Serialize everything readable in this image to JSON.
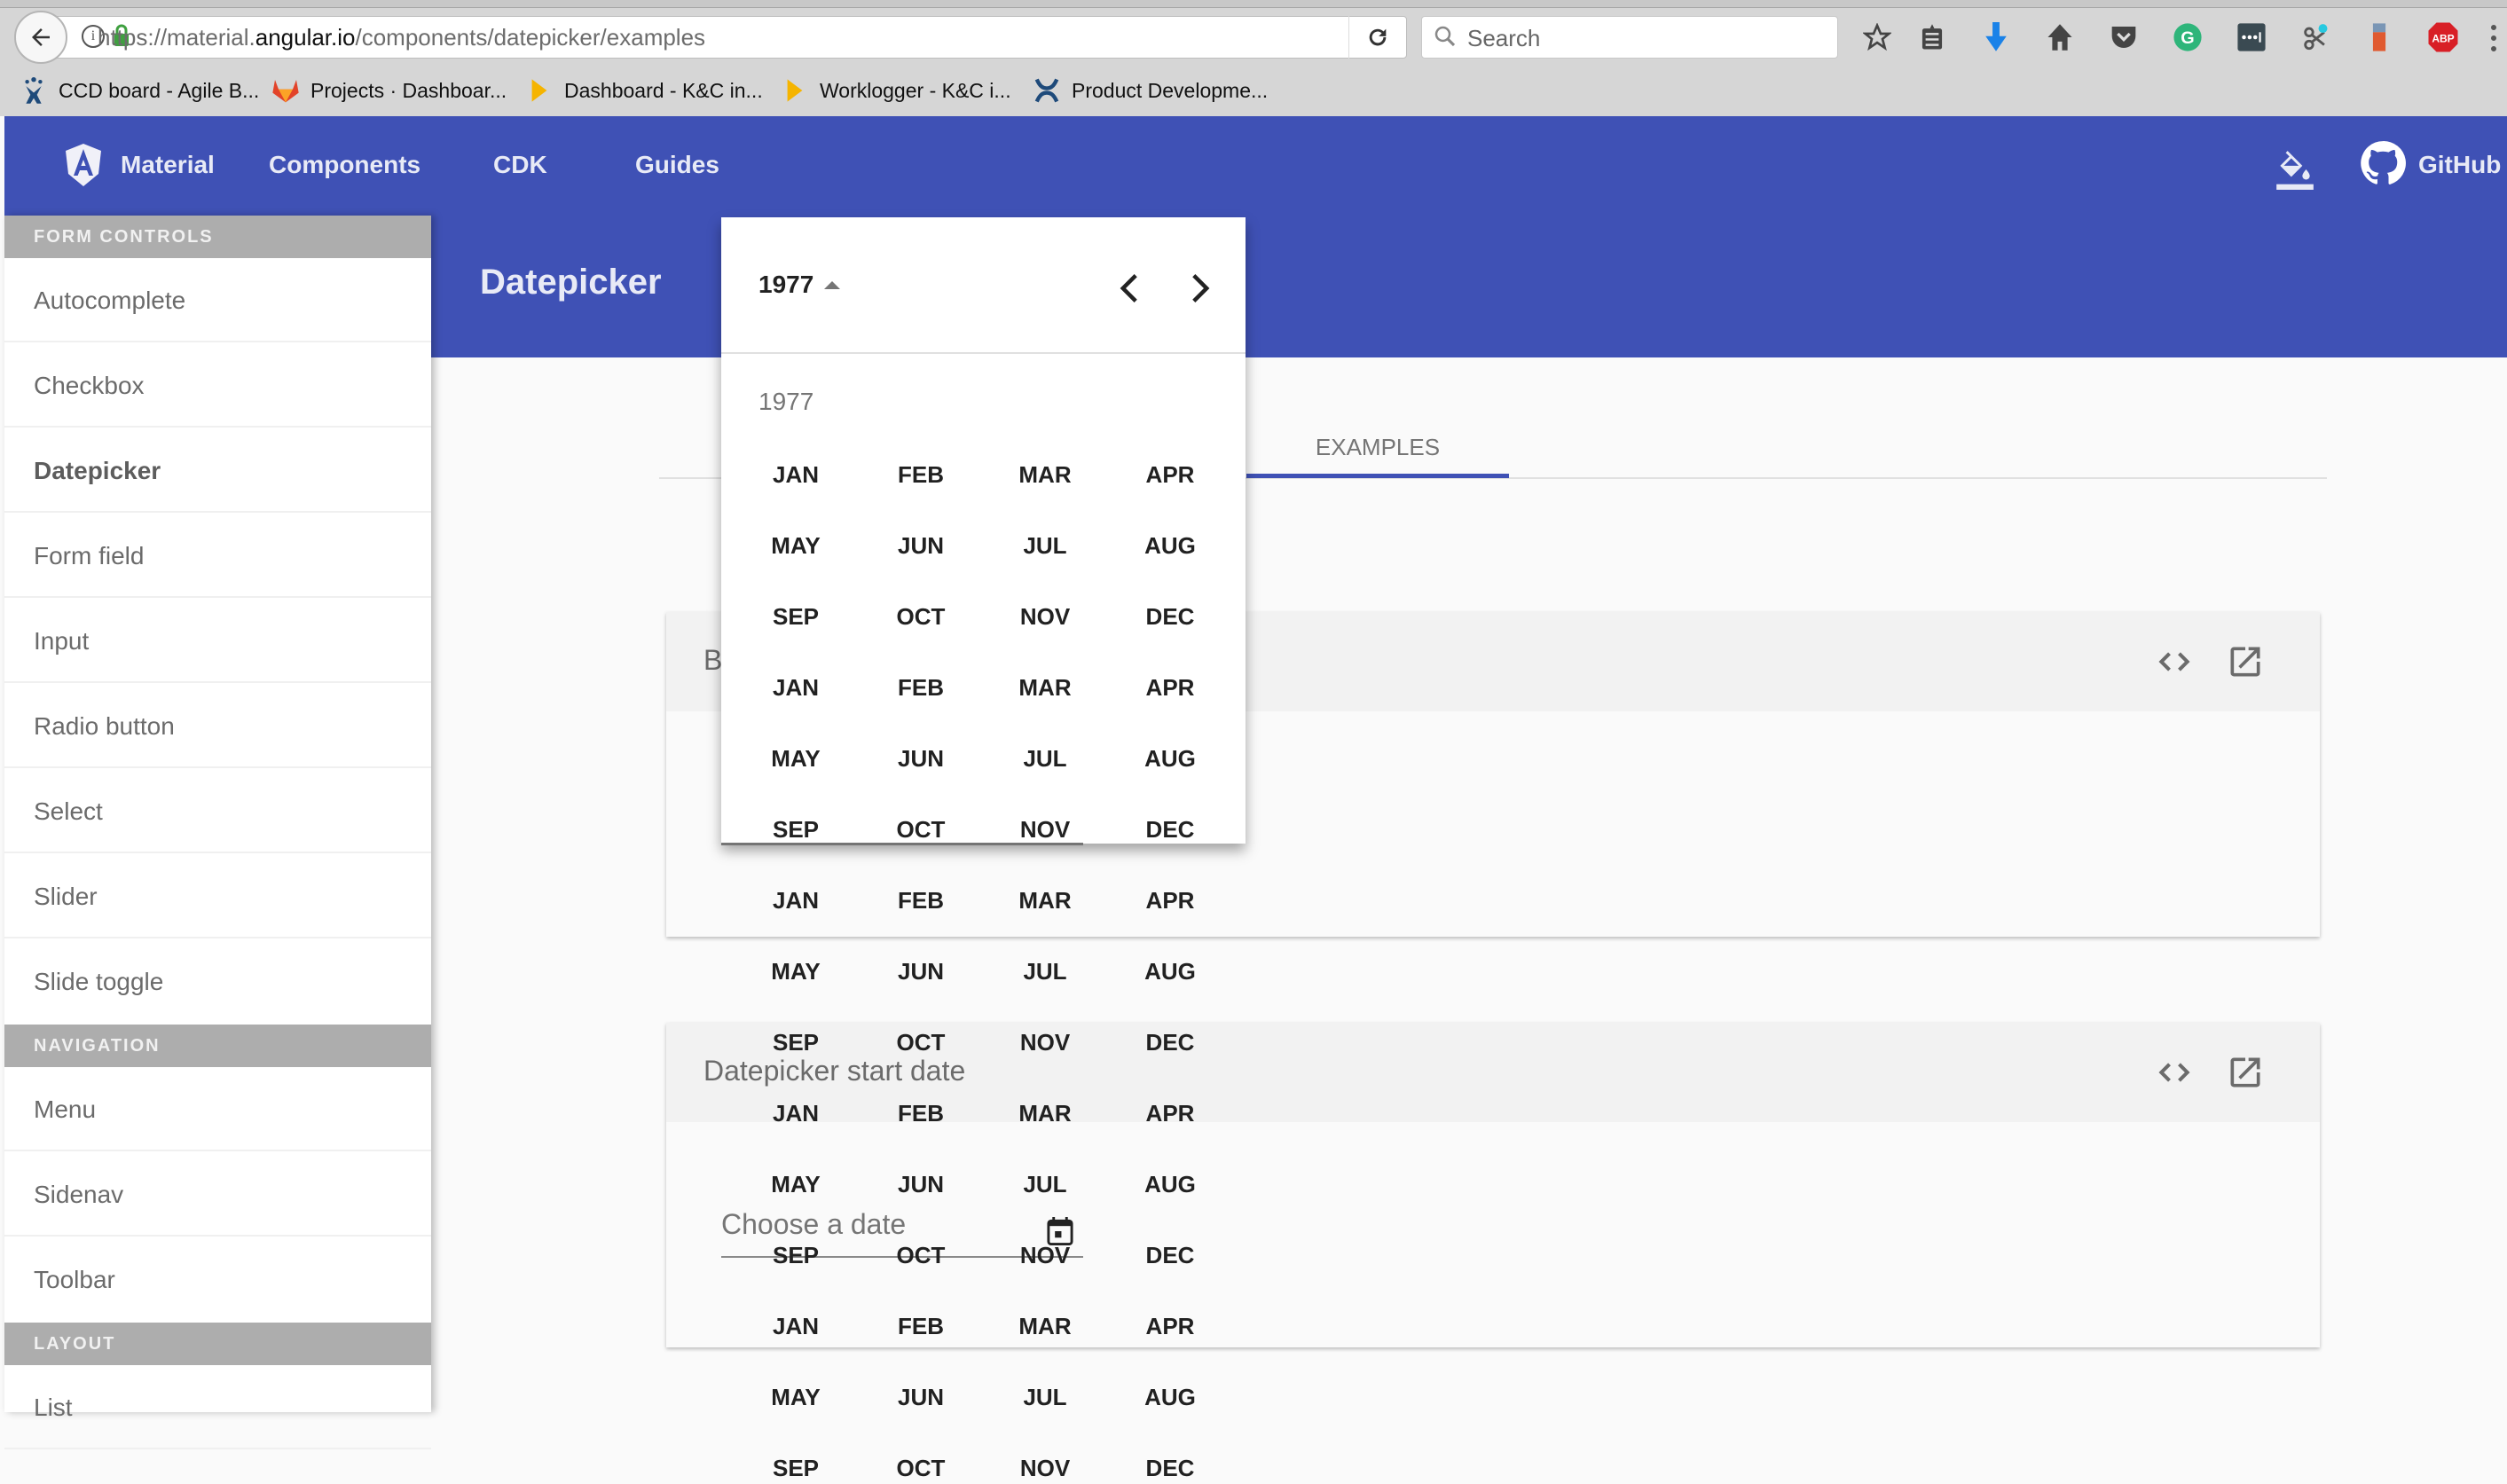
{
  "browser": {
    "url_prefix": "https://material.",
    "url_domain": "angular.io",
    "url_path": "/components/datepicker/examples",
    "search_placeholder": "Search",
    "toolbar_icons": [
      "bookmark-star-icon",
      "reading-list-icon",
      "downloads-icon",
      "home-icon",
      "pocket-icon",
      "grammarly-icon",
      "lastpass-icon",
      "screenshot-icon",
      "extension-icon",
      "adblock-plus-icon"
    ],
    "bookmarks": [
      {
        "label": "CCD board - Agile B...",
        "icon": "jira-icon"
      },
      {
        "label": "Projects · Dashboar...",
        "icon": "gitlab-icon"
      },
      {
        "label": "Dashboard - K&C in...",
        "icon": "folder-arrow-icon"
      },
      {
        "label": "Worklogger - K&C i...",
        "icon": "folder-arrow-icon"
      },
      {
        "label": "Product Developme...",
        "icon": "confluence-icon"
      }
    ]
  },
  "header": {
    "brand": "Material",
    "nav": [
      "Components",
      "CDK",
      "Guides"
    ],
    "github": "GitHub",
    "brand_color": "#3f51b5"
  },
  "sidebar": {
    "sections": [
      {
        "title": "FORM CONTROLS",
        "items": [
          "Autocomplete",
          "Checkbox",
          "Datepicker",
          "Form field",
          "Input",
          "Radio button",
          "Select",
          "Slider",
          "Slide toggle"
        ]
      },
      {
        "title": "NAVIGATION",
        "items": [
          "Menu",
          "Sidenav",
          "Toolbar"
        ]
      },
      {
        "title": "LAYOUT",
        "items": [
          "List"
        ]
      }
    ],
    "active": "Datepicker"
  },
  "page": {
    "title": "Datepicker",
    "tab": "EXAMPLES"
  },
  "cards": [
    {
      "title": "B"
    },
    {
      "title": "Datepicker start date"
    }
  ],
  "input": {
    "placeholder": "Choose a date"
  },
  "popup": {
    "period": "1977",
    "year_label": "1977",
    "months": [
      "JAN",
      "FEB",
      "MAR",
      "APR",
      "MAY",
      "JUN",
      "JUL",
      "AUG",
      "SEP",
      "OCT",
      "NOV",
      "DEC"
    ]
  }
}
